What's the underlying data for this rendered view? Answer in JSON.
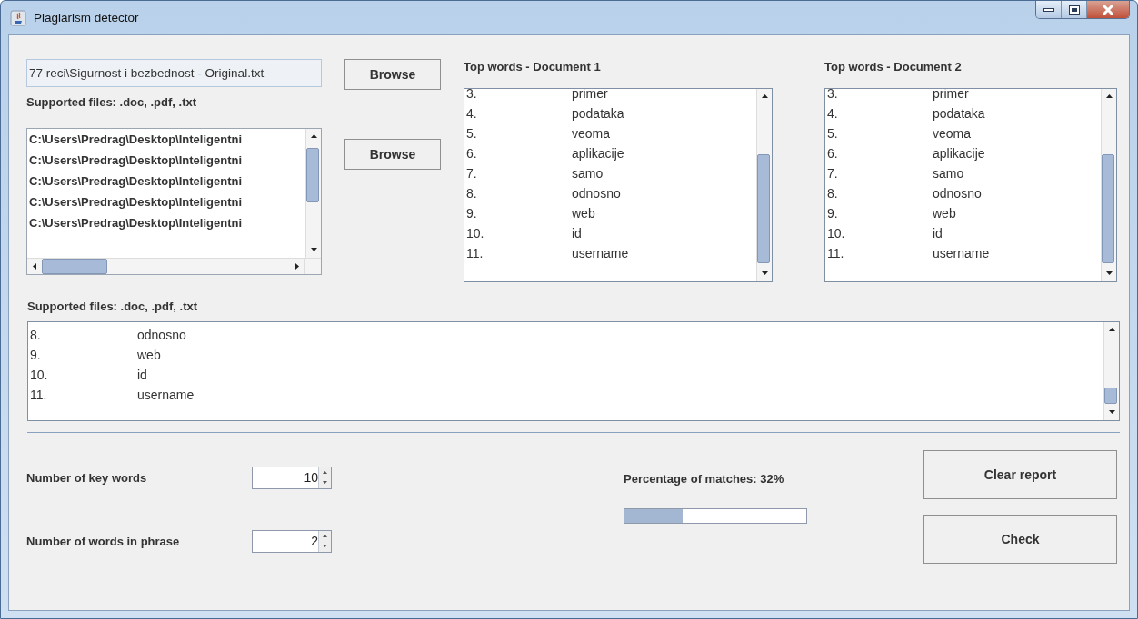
{
  "window": {
    "title": "Plagiarism detector"
  },
  "document_1": {
    "path_value": "77 reci\\Sigurnost i bezbednost - Original.txt",
    "browse_button": "Browse",
    "supported_files": "Supported files: .doc, .pdf, .txt"
  },
  "document_2": {
    "files": [
      "C:\\Users\\Predrag\\Desktop\\Inteligentni",
      "C:\\Users\\Predrag\\Desktop\\Inteligentni",
      "C:\\Users\\Predrag\\Desktop\\Inteligentni",
      "C:\\Users\\Predrag\\Desktop\\Inteligentni",
      "C:\\Users\\Predrag\\Desktop\\Inteligentni"
    ],
    "browse_button": "Browse",
    "supported_files": "Supported files: .doc, .pdf, .txt"
  },
  "top_words": [
    {
      "title": "Top words - Document 1",
      "rows": [
        {
          "rank": "3.",
          "word": "primer"
        },
        {
          "rank": "4.",
          "word": "podataka"
        },
        {
          "rank": "5.",
          "word": "veoma"
        },
        {
          "rank": "6.",
          "word": "aplikacije"
        },
        {
          "rank": "7.",
          "word": "samo"
        },
        {
          "rank": "8.",
          "word": "odnosno"
        },
        {
          "rank": "9.",
          "word": "web"
        },
        {
          "rank": "10.",
          "word": "id"
        },
        {
          "rank": "11.",
          "word": "username"
        }
      ]
    },
    {
      "title": "Top words - Document 2",
      "rows": [
        {
          "rank": "3.",
          "word": "primer"
        },
        {
          "rank": "4.",
          "word": "podataka"
        },
        {
          "rank": "5.",
          "word": "veoma"
        },
        {
          "rank": "6.",
          "word": "aplikacije"
        },
        {
          "rank": "7.",
          "word": "samo"
        },
        {
          "rank": "8.",
          "word": "odnosno"
        },
        {
          "rank": "9.",
          "word": "web"
        },
        {
          "rank": "10.",
          "word": "id"
        },
        {
          "rank": "11.",
          "word": "username"
        }
      ]
    }
  ],
  "report": {
    "rows": [
      {
        "rank": "8.",
        "word": "odnosno"
      },
      {
        "rank": "9.",
        "word": "web"
      },
      {
        "rank": "10.",
        "word": "id"
      },
      {
        "rank": "11.",
        "word": "username"
      }
    ]
  },
  "settings": [
    {
      "label": "Number of key words",
      "value": "10"
    },
    {
      "label": "Number of words in phrase",
      "value": "2"
    }
  ],
  "match": {
    "label": "Percentage of matches: 32%",
    "level": 0.32
  },
  "buttons": [
    "Clear report",
    "Check"
  ]
}
